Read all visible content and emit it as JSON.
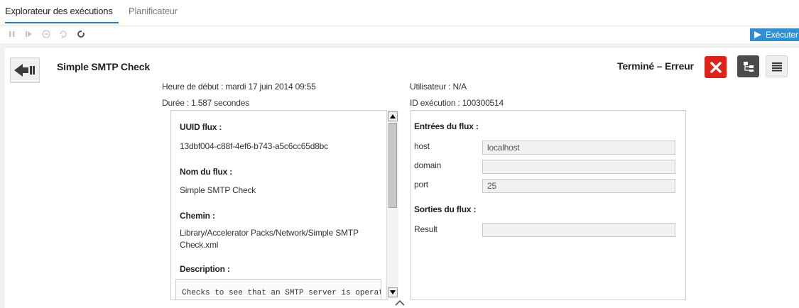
{
  "tabs": [
    {
      "label": "Explorateur des exécutions",
      "active": true
    },
    {
      "label": "Planificateur",
      "active": false
    }
  ],
  "toolbar": {
    "icons": [
      "pause-icon",
      "resume-icon",
      "cancel-icon",
      "reassign-icon",
      "refresh-icon"
    ],
    "run_label": "Exécuter"
  },
  "flow": {
    "title": "Simple SMTP Check",
    "status": "Terminé – Erreur",
    "status_color": "#e0231a",
    "start_time": "Heure de début : mardi 17 juin 2014 09:55",
    "duration": "Durée : 1.587 secondes",
    "user": "Utilisateur : N/A",
    "run_id": "ID exécution : 100300514"
  },
  "details": {
    "uuid_label": "UUID flux :",
    "uuid_value": "13dbf004-c88f-4ef6-b743-a5c6cc65d8bc",
    "name_label": "Nom du flux :",
    "name_value": "Simple SMTP Check",
    "path_label": "Chemin :",
    "path_value": "Library/Accelerator Packs/Network/Simple SMTP Check.xml",
    "description_label": "Description :",
    "description_value": "Checks to see that an SMTP server is operati"
  },
  "io": {
    "inputs_title": "Entrées du flux :",
    "inputs": [
      {
        "name": "host",
        "value": "localhost"
      },
      {
        "name": "domain",
        "value": ""
      },
      {
        "name": "port",
        "value": "25"
      }
    ],
    "outputs_title": "Sorties du flux :",
    "outputs": [
      {
        "name": "Result",
        "value": ""
      }
    ]
  },
  "colors": {
    "accent": "#2a7ab8",
    "run_button": "#2f8fd1",
    "error": "#e0231a"
  }
}
